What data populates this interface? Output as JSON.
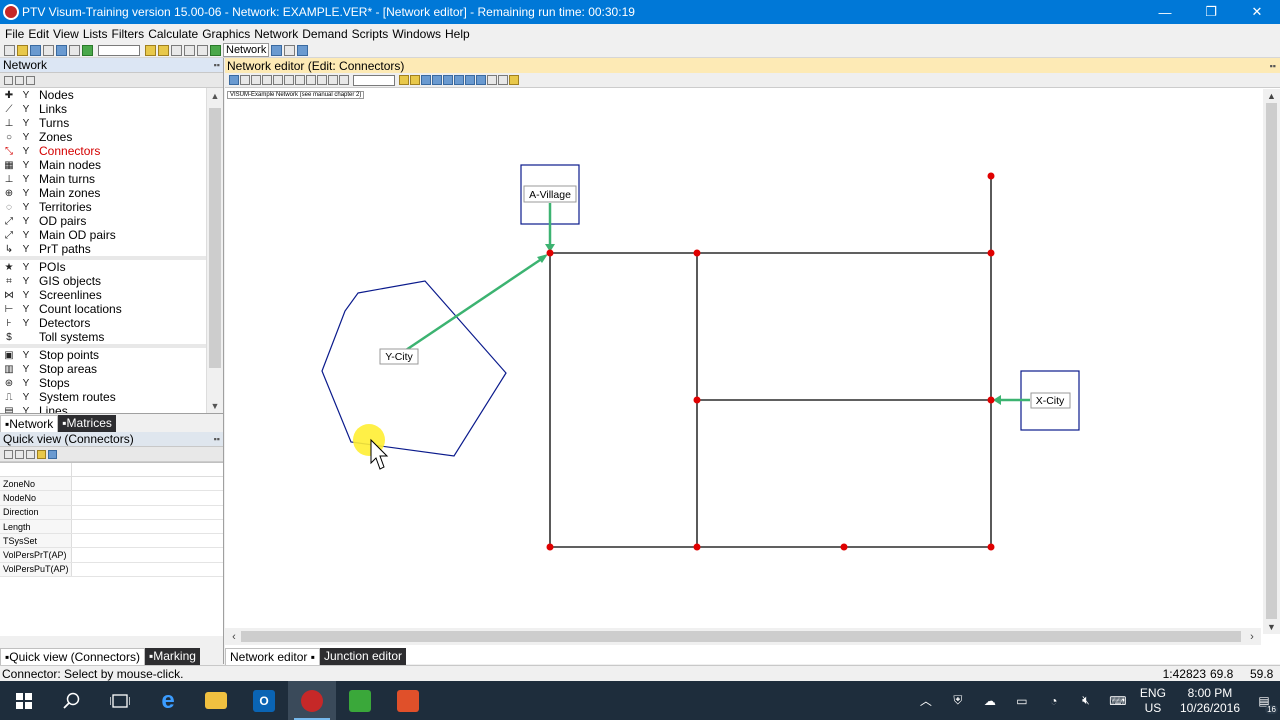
{
  "window": {
    "title": "PTV Visum-Training version 15.00-06 - Network: EXAMPLE.VER* - [Network editor] - Remaining run time: 00:30:19",
    "minimize": "—",
    "maximize": "❐",
    "close": "✕"
  },
  "menu": [
    "File",
    "Edit",
    "View",
    "Lists",
    "Filters",
    "Calculate",
    "Graphics",
    "Network",
    "Demand",
    "Scripts",
    "Windows",
    "Help"
  ],
  "toolbar": {
    "network_label": "Network"
  },
  "network_pane": {
    "title": "Network",
    "groups": [
      [
        {
          "label": "Nodes",
          "icon": "node-icon",
          "glyph": "✚"
        },
        {
          "label": "Links",
          "icon": "link-icon",
          "glyph": "⟋"
        },
        {
          "label": "Turns",
          "icon": "turn-icon",
          "glyph": "⊥"
        },
        {
          "label": "Zones",
          "icon": "zone-icon",
          "glyph": "○"
        },
        {
          "label": "Connectors",
          "icon": "connector-icon",
          "glyph": "⤡",
          "selected": true
        },
        {
          "label": "Main nodes",
          "icon": "main-node-icon",
          "glyph": "▦"
        },
        {
          "label": "Main turns",
          "icon": "main-turn-icon",
          "glyph": "⊥"
        },
        {
          "label": "Main zones",
          "icon": "main-zone-icon",
          "glyph": "⊕"
        },
        {
          "label": "Territories",
          "icon": "territory-icon",
          "glyph": "◌"
        },
        {
          "label": "OD pairs",
          "icon": "od-pair-icon",
          "glyph": "⤢"
        },
        {
          "label": "Main OD pairs",
          "icon": "main-od-pair-icon",
          "glyph": "⤢"
        },
        {
          "label": "PrT paths",
          "icon": "prt-path-icon",
          "glyph": "↳"
        }
      ],
      [
        {
          "label": "POIs",
          "icon": "poi-icon",
          "glyph": "★"
        },
        {
          "label": "GIS objects",
          "icon": "gis-object-icon",
          "glyph": "⌗"
        },
        {
          "label": "Screenlines",
          "icon": "screenline-icon",
          "glyph": "⋈"
        },
        {
          "label": "Count locations",
          "icon": "count-location-icon",
          "glyph": "⊢"
        },
        {
          "label": "Detectors",
          "icon": "detector-icon",
          "glyph": "⊦"
        },
        {
          "label": "Toll systems",
          "icon": "toll-system-icon",
          "glyph": "$",
          "no_filter": true
        }
      ],
      [
        {
          "label": "Stop points",
          "icon": "stop-point-icon",
          "glyph": "▣"
        },
        {
          "label": "Stop areas",
          "icon": "stop-area-icon",
          "glyph": "▥"
        },
        {
          "label": "Stops",
          "icon": "stop-icon",
          "glyph": "⊛"
        },
        {
          "label": "System routes",
          "icon": "system-route-icon",
          "glyph": "⎍"
        },
        {
          "label": "Lines",
          "icon": "line-icon",
          "glyph": "▤"
        }
      ]
    ],
    "tabs": [
      "Network",
      "Matrices"
    ]
  },
  "quick_view": {
    "title": "Quick view (Connectors)",
    "rows": [
      "ZoneNo",
      "NodeNo",
      "Direction",
      "Length",
      "TSysSet",
      "VolPersPrT(AP)",
      "VolPersPuT(AP)"
    ]
  },
  "left_bottom_tabs": [
    "Quick view (Connectors)",
    "Marking"
  ],
  "editor": {
    "title": "Network editor (Edit: Connectors)",
    "canvas_tag": "VISUM-Example Network (see manual chapter 2)",
    "zones": [
      {
        "label": "A-Village",
        "kind": "rectangle"
      },
      {
        "label": "Y-City",
        "kind": "polygon"
      },
      {
        "label": "X-City",
        "kind": "rectangle"
      }
    ],
    "tabs": [
      "Network editor",
      "Junction editor"
    ],
    "colors": {
      "link": "#000000",
      "node": "#e00000",
      "zone": "#0a1a8c",
      "connector": "#3cb371",
      "cursor_highlight": "#ffee33"
    }
  },
  "status": {
    "message": "Connector: Select by mouse-click.",
    "scale": "1:42823",
    "coord_x": "69.8",
    "coord_y": "59.8"
  },
  "taskbar": {
    "lang": "ENG",
    "region": "US",
    "time": "8:00 PM",
    "date": "10/26/2016",
    "notifications": "16"
  }
}
